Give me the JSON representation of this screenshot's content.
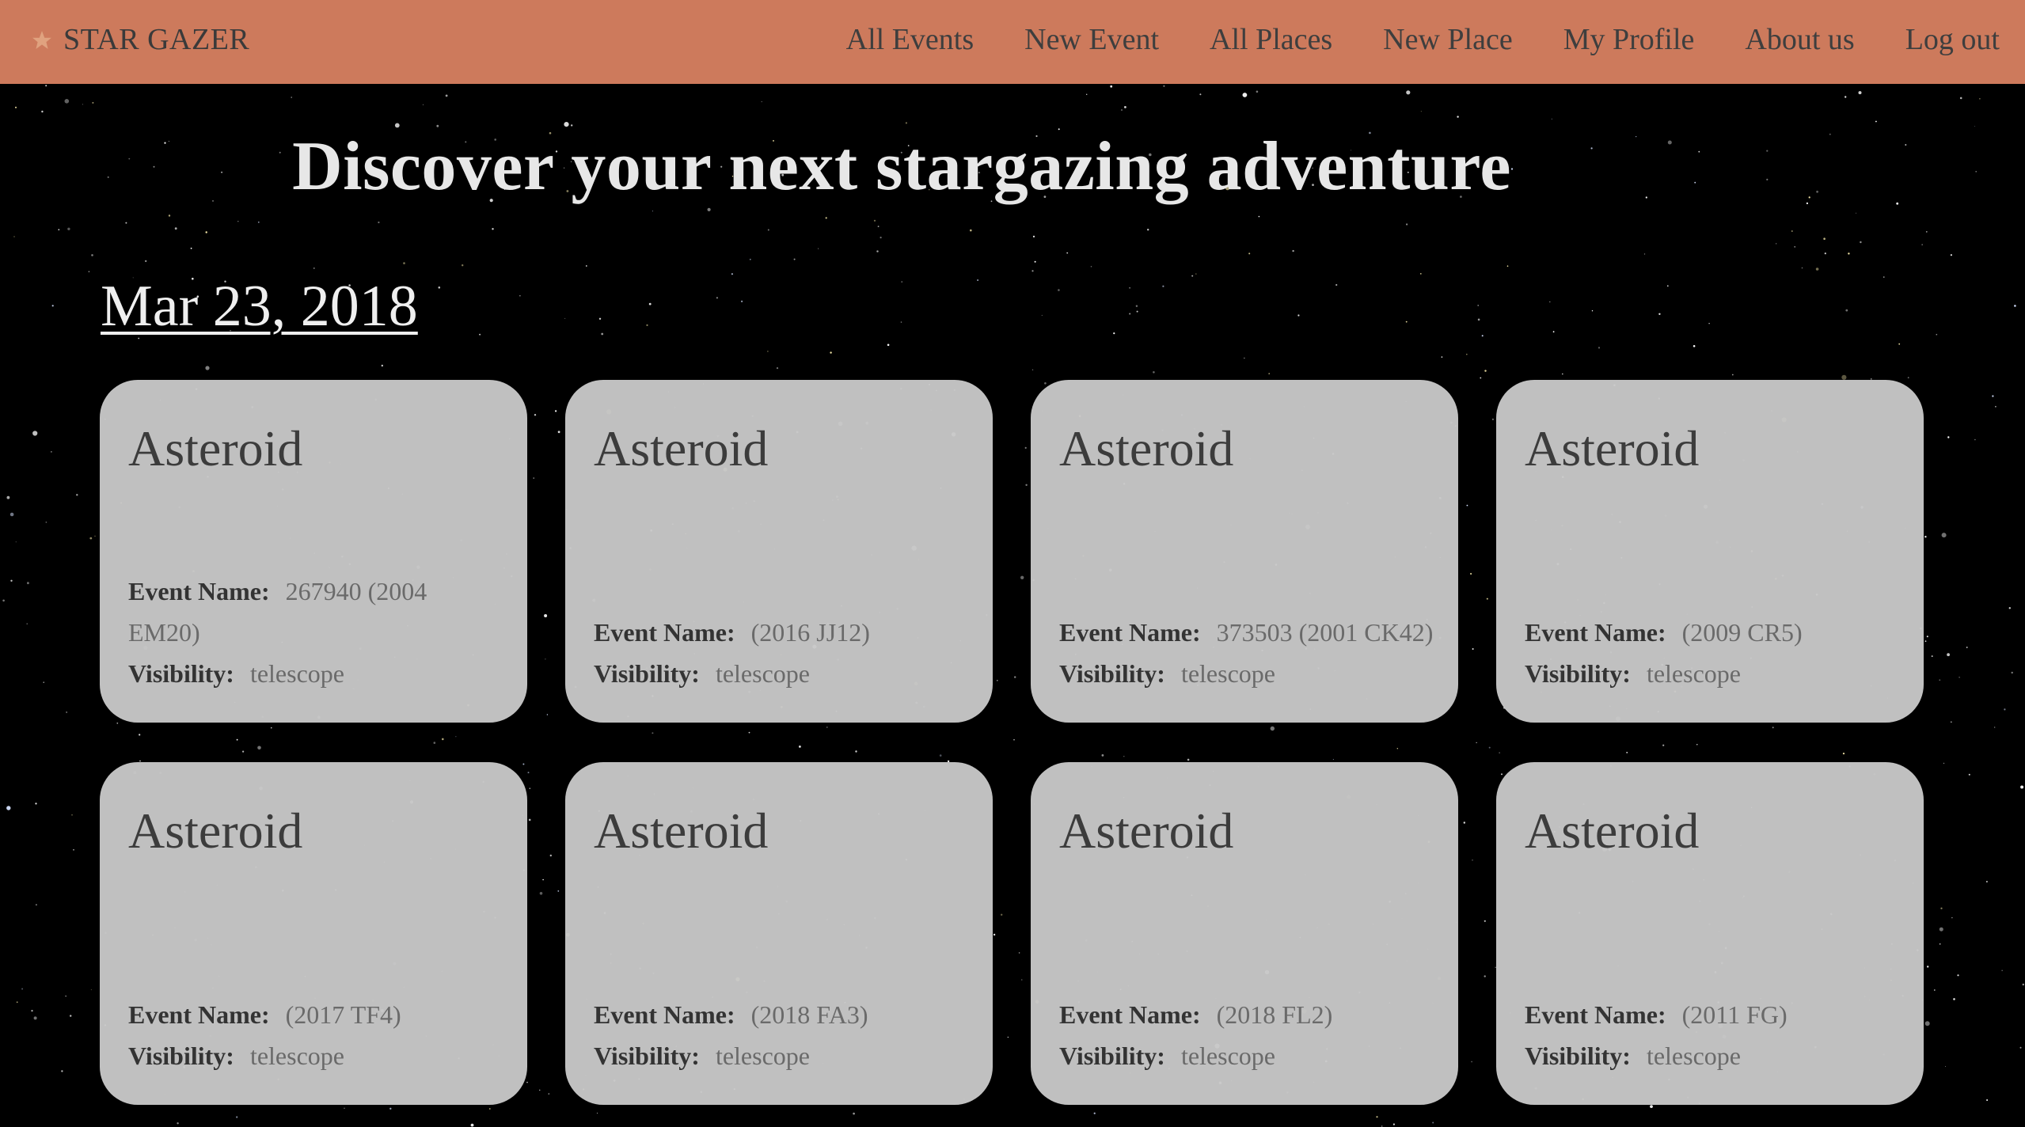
{
  "nav": {
    "brand": "STAR GAZER",
    "links": [
      "All Events",
      "New Event",
      "All Places",
      "New Place",
      "My Profile",
      "About us",
      "Log out"
    ]
  },
  "hero": {
    "title": "Discover your next stargazing adventure"
  },
  "date_heading": "Mar 23, 2018",
  "labels": {
    "event_name": "Event Name:",
    "visibility": "Visibility:"
  },
  "events": [
    {
      "title": "Asteroid",
      "event_name": "267940 (2004 EM20)",
      "visibility": "telescope"
    },
    {
      "title": "Asteroid",
      "event_name": "(2016 JJ12)",
      "visibility": "telescope"
    },
    {
      "title": "Asteroid",
      "event_name": "373503 (2001 CK42)",
      "visibility": "telescope"
    },
    {
      "title": "Asteroid",
      "event_name": "(2009 CR5)",
      "visibility": "telescope"
    },
    {
      "title": "Asteroid",
      "event_name": "(2017 TF4)",
      "visibility": "telescope"
    },
    {
      "title": "Asteroid",
      "event_name": "(2018 FA3)",
      "visibility": "telescope"
    },
    {
      "title": "Asteroid",
      "event_name": "(2018 FL2)",
      "visibility": "telescope"
    },
    {
      "title": "Asteroid",
      "event_name": "(2011 FG)",
      "visibility": "telescope"
    }
  ],
  "colors": {
    "navbar": "#cd7a5c",
    "background": "#000000",
    "card": "#c8c8c8"
  },
  "icons": {
    "brand": "star-icon"
  }
}
